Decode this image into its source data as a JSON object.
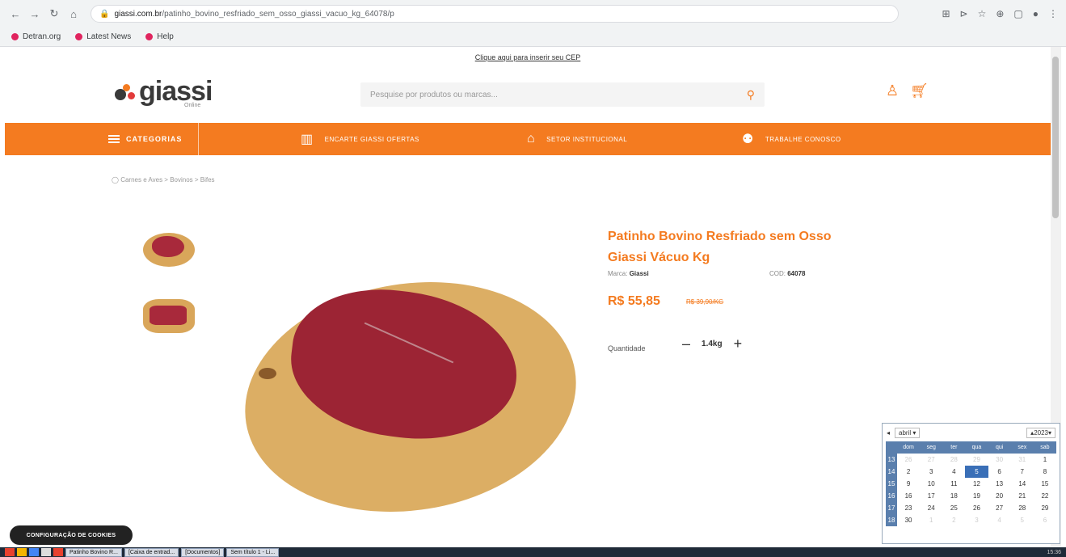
{
  "browser": {
    "url_domain": "giassi.com.br",
    "url_path": "/patinho_bovino_resfriado_sem_osso_giassi_vacuo_kg_64078/p",
    "bookmarks": [
      {
        "label": "Detran.org"
      },
      {
        "label": "Latest News"
      },
      {
        "label": "Help"
      }
    ]
  },
  "header": {
    "promo_text": "Clique aqui para inserir seu CEP",
    "logo_text": "giassi",
    "logo_sub": "Online",
    "search_placeholder": "Pesquise por produtos ou marcas...",
    "colors": {
      "brand": "#f47b20"
    }
  },
  "nav": {
    "categories_label": "CATEGORIAS",
    "items": [
      {
        "label": "ENCARTE GIASSI OFERTAS",
        "icon": "book-icon"
      },
      {
        "label": "SETOR INSTITUCIONAL",
        "icon": "home-icon"
      },
      {
        "label": "TRABALHE CONOSCO",
        "icon": "users-icon"
      }
    ]
  },
  "breadcrumb": "Carnes e Aves > Bovinos > Bifes",
  "product": {
    "title": "Patinho Bovino Resfriado sem Osso Giassi Vácuo Kg",
    "brand_label": "Marca:",
    "brand_value": "Giassi",
    "sku_label": "COD:",
    "sku_value": "64078",
    "price": "R$ 55,85",
    "old_price": "R$ 39,90/KG",
    "quantity_label": "Quantidade",
    "quantity_value": "1.4kg",
    "minus_label": "–",
    "plus_label": "+"
  },
  "cookie_button": "CONFIGURAÇÃO DE COOKIES",
  "calendar": {
    "month": "abril",
    "year": "2023",
    "day_headers": [
      "dom",
      "seg",
      "ter",
      "qua",
      "qui",
      "sex",
      "sab"
    ],
    "weeks": [
      {
        "wk": "13",
        "days": [
          "26",
          "27",
          "28",
          "29",
          "30",
          "31",
          "1"
        ]
      },
      {
        "wk": "14",
        "days": [
          "2",
          "3",
          "4",
          "5",
          "6",
          "7",
          "8"
        ]
      },
      {
        "wk": "15",
        "days": [
          "9",
          "10",
          "11",
          "12",
          "13",
          "14",
          "15"
        ]
      },
      {
        "wk": "16",
        "days": [
          "16",
          "17",
          "18",
          "19",
          "20",
          "21",
          "22"
        ]
      },
      {
        "wk": "17",
        "days": [
          "23",
          "24",
          "25",
          "26",
          "27",
          "28",
          "29"
        ]
      },
      {
        "wk": "18",
        "days": [
          "30",
          "1",
          "2",
          "3",
          "4",
          "5",
          "6"
        ]
      }
    ],
    "today": "5"
  },
  "taskbar": {
    "apps": [
      {
        "label": "Patinho Bovino R..."
      },
      {
        "label": "[Caixa de entrad..."
      },
      {
        "label": "[Documentos]"
      },
      {
        "label": "Sem título 1 - Li..."
      }
    ],
    "clock": "15:36"
  }
}
